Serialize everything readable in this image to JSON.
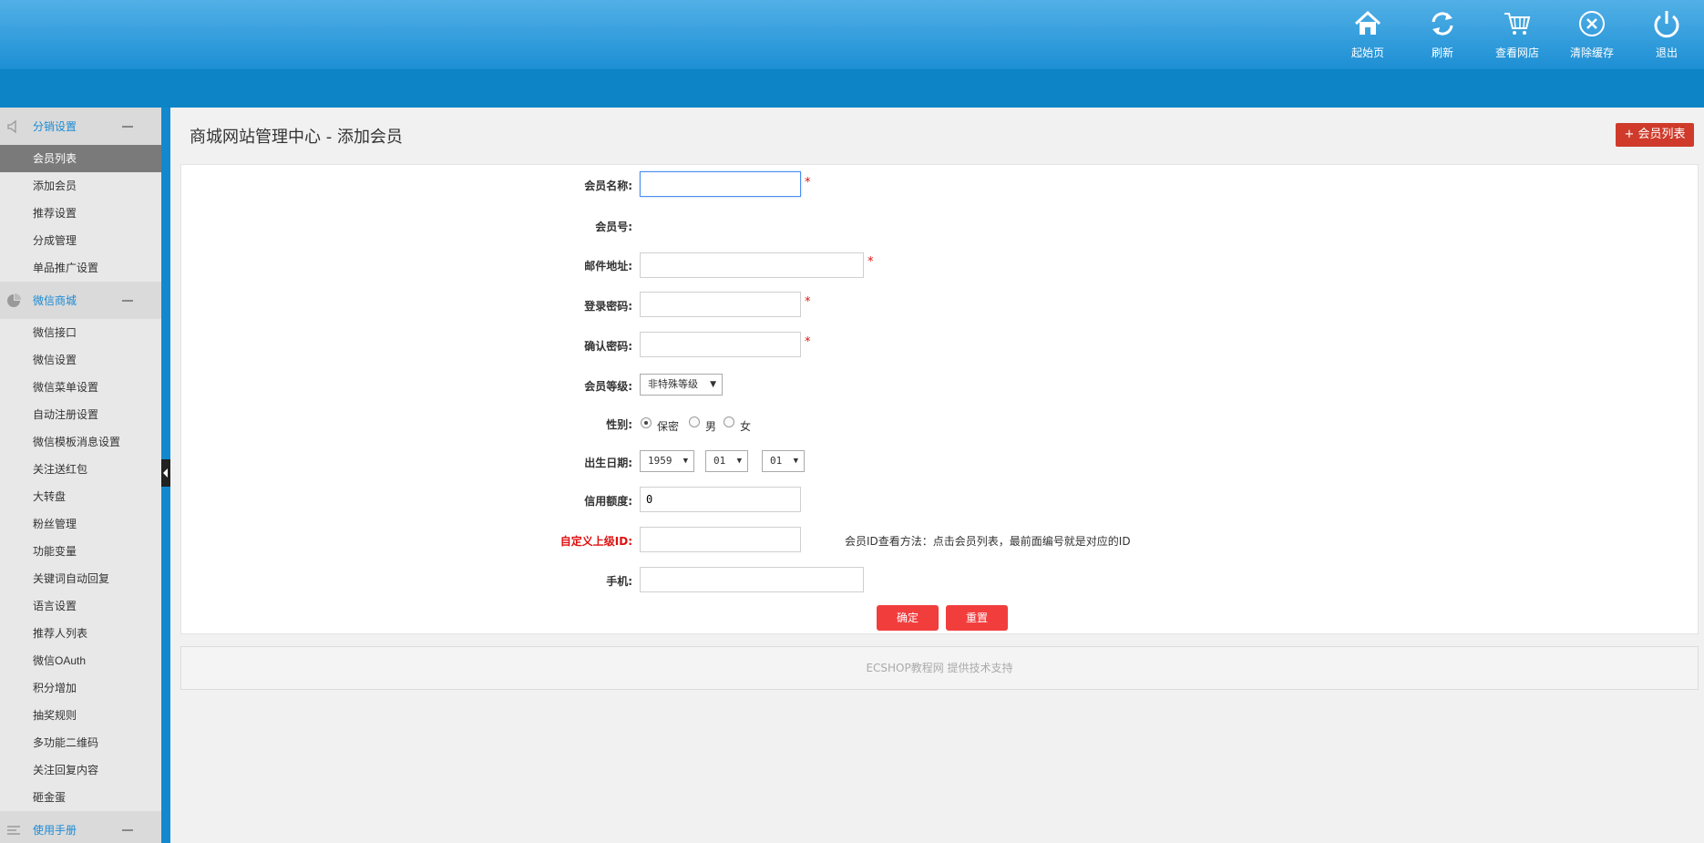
{
  "header": {
    "nav": [
      {
        "label": "起始页",
        "icon": "home-icon"
      },
      {
        "label": "刷新",
        "icon": "refresh-icon"
      },
      {
        "label": "查看网店",
        "icon": "cart-icon"
      },
      {
        "label": "清除缓存",
        "icon": "close-circle-icon"
      },
      {
        "label": "退出",
        "icon": "power-icon"
      }
    ]
  },
  "sidebar": {
    "group1": {
      "title": "分销设置",
      "icon": "speaker-icon",
      "items": [
        "会员列表",
        "添加会员",
        "推荐设置",
        "分成管理",
        "单品推广设置"
      ]
    },
    "group2": {
      "title": "微信商城",
      "icon": "pie-chart-icon",
      "items": [
        "微信接口",
        "微信设置",
        "微信菜单设置",
        "自动注册设置",
        "微信模板消息设置",
        "关注送红包",
        "大转盘",
        "粉丝管理",
        "功能变量",
        "关键词自动回复",
        "语言设置",
        "推荐人列表",
        "微信OAuth",
        "积分增加",
        "抽奖规则",
        "多功能二维码",
        "关注回复内容",
        "砸金蛋"
      ]
    },
    "group3": {
      "title": "使用手册",
      "icon": "list-icon"
    }
  },
  "main": {
    "title": "商城网站管理中心 - 添加会员",
    "list_button": "会员列表",
    "form": {
      "username_label": "会员名称:",
      "member_no_label": "会员号:",
      "email_label": "邮件地址:",
      "password_label": "登录密码:",
      "confirm_label": "确认密码:",
      "rank_label": "会员等级:",
      "rank_value": "非特殊等级",
      "gender_label": "性别:",
      "gender_options": [
        "保密",
        "男",
        "女"
      ],
      "birthday_label": "出生日期:",
      "birth_year": "1959",
      "birth_month": "01",
      "birth_day": "01",
      "credit_label": "信用额度:",
      "credit_value": "0",
      "parent_label": "自定义上级ID:",
      "parent_hint": "会员ID查看方法：点击会员列表，最前面编号就是对应的ID",
      "mobile_label": "手机:",
      "required_mark": "*",
      "submit": "确定",
      "reset": "重置"
    },
    "footer": "ECSHOP教程网 提供技术支持"
  }
}
